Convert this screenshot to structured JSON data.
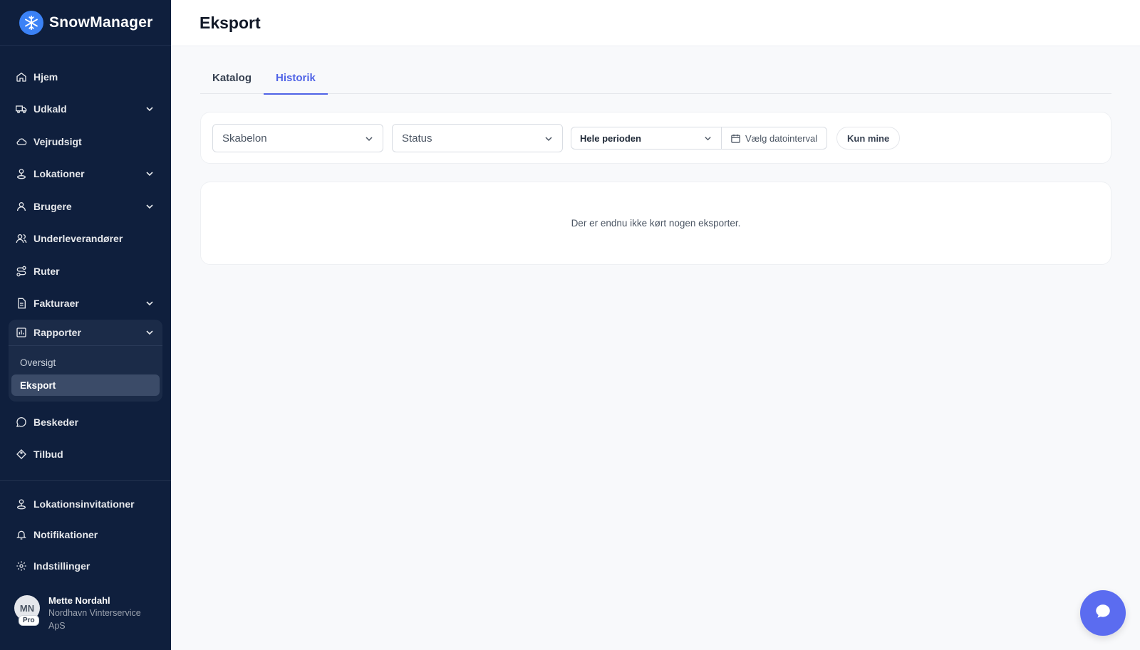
{
  "brand": {
    "name": "SnowManager",
    "logo_icon": "snowflake-icon",
    "accent": "#3b82f6"
  },
  "sidebar": {
    "items": [
      {
        "label": "Hjem",
        "icon": "home-icon",
        "expandable": false
      },
      {
        "label": "Udkald",
        "icon": "truck-icon",
        "expandable": true
      },
      {
        "label": "Vejrudsigt",
        "icon": "cloud-icon",
        "expandable": false
      },
      {
        "label": "Lokationer",
        "icon": "map-pin-icon",
        "expandable": true
      },
      {
        "label": "Brugere",
        "icon": "user-icon",
        "expandable": true
      },
      {
        "label": "Underleverandører",
        "icon": "users-icon",
        "expandable": false
      },
      {
        "label": "Ruter",
        "icon": "route-icon",
        "expandable": false
      },
      {
        "label": "Fakturaer",
        "icon": "invoice-icon",
        "expandable": true
      }
    ],
    "reports_group": {
      "label": "Rapporter",
      "icon": "bar-chart-icon",
      "children": [
        {
          "label": "Oversigt",
          "active": false
        },
        {
          "label": "Eksport",
          "active": true
        }
      ]
    },
    "items_after": [
      {
        "label": "Beskeder",
        "icon": "message-icon"
      },
      {
        "label": "Tilbud",
        "icon": "offer-icon"
      }
    ],
    "bottom_items": [
      {
        "label": "Lokationsinvitationer",
        "icon": "location-invite-icon"
      },
      {
        "label": "Notifikationer",
        "icon": "bell-icon"
      },
      {
        "label": "Indstillinger",
        "icon": "gear-icon"
      }
    ],
    "user": {
      "initials": "MN",
      "badge": "Pro",
      "name": "Mette Nordahl",
      "company": "Nordhavn Vinterservice ApS"
    }
  },
  "header": {
    "title": "Eksport"
  },
  "tabs": [
    {
      "label": "Katalog",
      "active": false
    },
    {
      "label": "Historik",
      "active": true
    }
  ],
  "filters": {
    "template": {
      "value": "Skabelon"
    },
    "status": {
      "value": "Status"
    },
    "period": {
      "value": "Hele perioden"
    },
    "date_range": {
      "label": "Vælg datointerval"
    },
    "only_mine": {
      "label": "Kun mine"
    }
  },
  "empty_state": {
    "text": "Der er endnu ikke kørt nogen eksporter."
  },
  "colors": {
    "sidebar_bg": "#0f1f3d",
    "accent": "#4f63e6",
    "chat_button": "#5b6cf0"
  }
}
